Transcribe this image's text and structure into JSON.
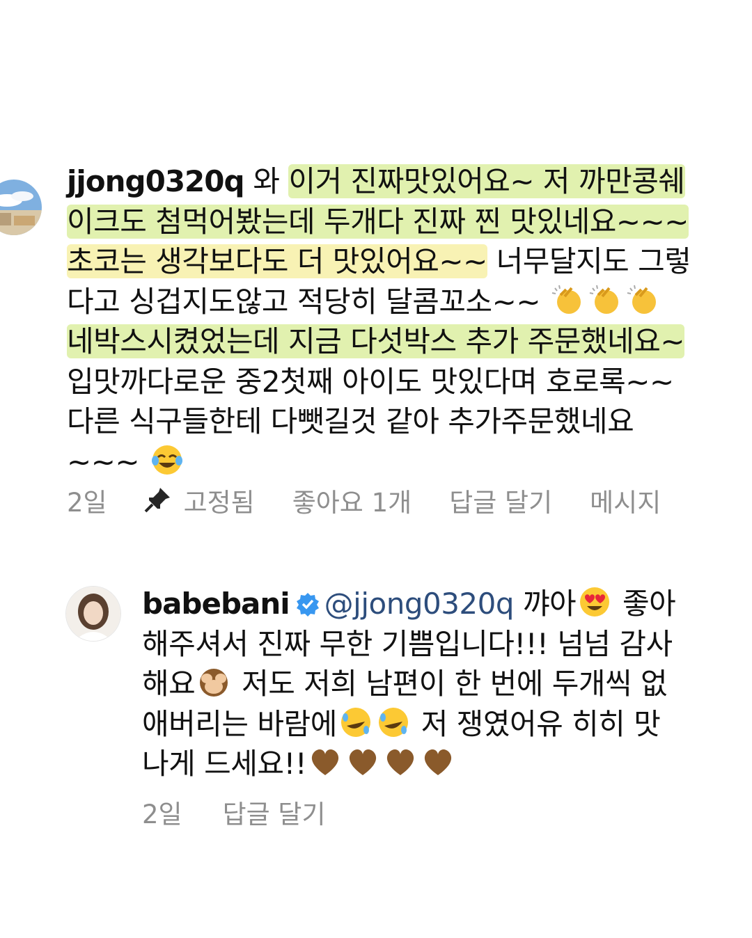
{
  "comment1": {
    "username": "jjong0320q",
    "lines": [
      {
        "plain": " 와 ",
        "green": "이거 진짜맛있어요~ 저 까만콩쉐"
      },
      {
        "green": "이크도 첨먹어봤는데 두개다 진짜 찐 맛있네요~~~"
      },
      {
        "yellow": "초코는 생각보다도 더 맛있어요~~",
        "plain": " 너무달지도 그렇"
      },
      {
        "plain": "다고 싱겁지도않고 적당히 달콤꼬소~~"
      },
      {
        "green": "네박스시켰었는데 지금 다섯박스 추가 주문했네요~"
      },
      {
        "plain": "입맛까다로운 중2첫째 아이도 맛있다며 호로록~~"
      },
      {
        "plain": "다른 식구들한테 다뺏길것 같아 추가주문했네요"
      },
      {
        "plain": "~~~"
      }
    ],
    "time": "2일",
    "pinned_label": "고정됨",
    "likes": "좋아요 1개",
    "reply": "답글 달기",
    "message": "메시지",
    "emojis": [
      "clapping-hands-emoji",
      "clapping-hands-emoji",
      "clapping-hands-emoji",
      "tears-of-joy-emoji"
    ]
  },
  "comment2": {
    "username": "babebani",
    "mention": "@jjong0320q",
    "lines": [
      {
        "a": " 꺄아",
        "b": " 좋아"
      },
      {
        "a": "해주셔서 진짜 무한 기쁨입니다!!! 넘넘 감사"
      },
      {
        "a": "해요",
        "b": " 저도 저희 남편이 한 번에 두개씩 없"
      },
      {
        "a": "애버리는 바람에",
        "b": " 저 쟁였어유 히히 맛"
      },
      {
        "a": "나게 드세요!!"
      }
    ],
    "time": "2일",
    "reply": "답글 달기",
    "emojis": [
      "heart-eyes-emoji",
      "see-no-evil-monkey-emoji",
      "rofl-emoji",
      "rofl-emoji",
      "brown-heart-emoji",
      "brown-heart-emoji",
      "brown-heart-emoji",
      "brown-heart-emoji"
    ]
  },
  "colors": {
    "mention": "#2d4d7c",
    "meta": "#8e8e8e",
    "verified": "#3897f0",
    "highlight_green": "#c8e66e",
    "highlight_yellow": "#f5eb8c"
  }
}
